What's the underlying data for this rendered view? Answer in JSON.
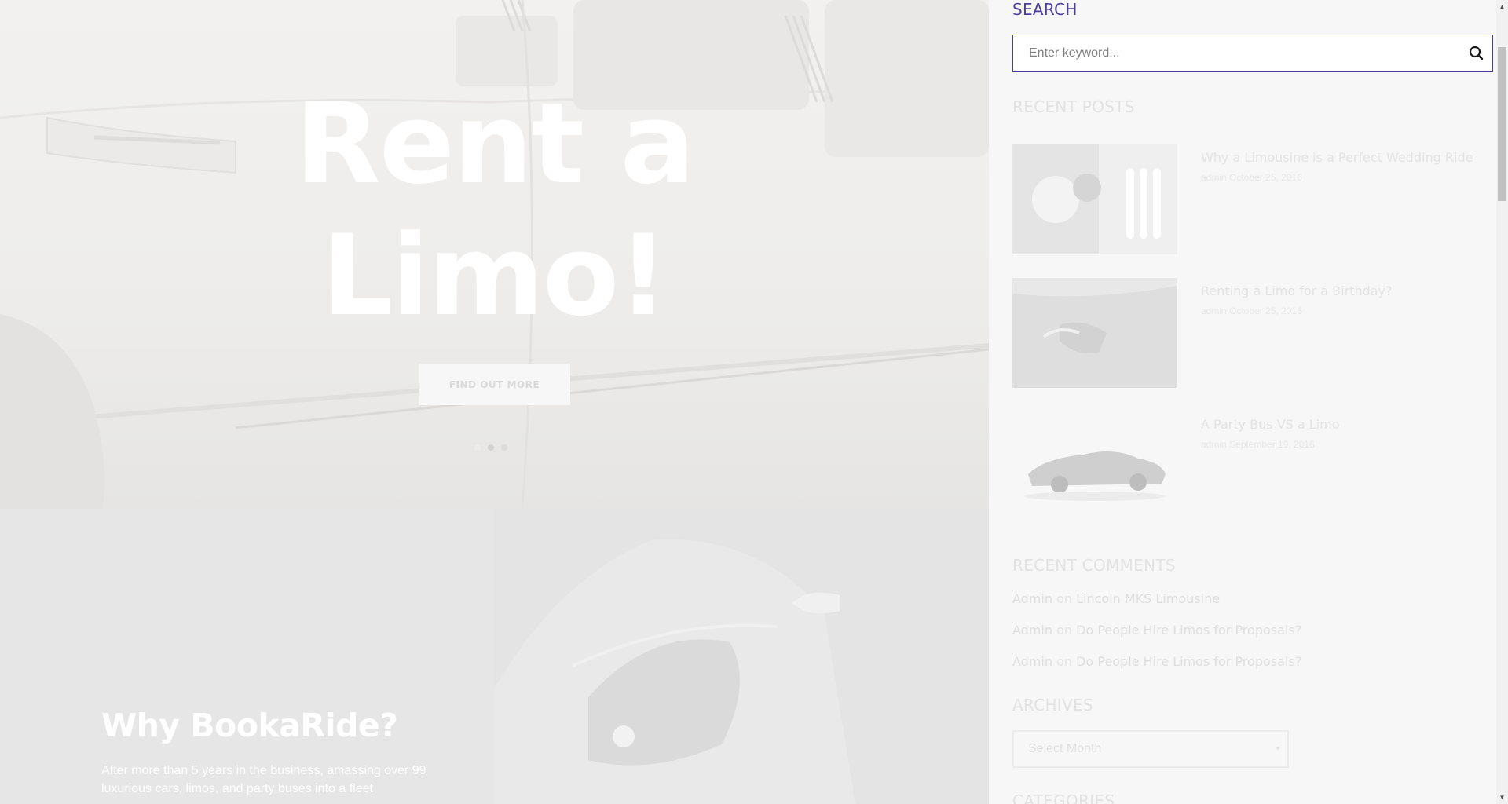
{
  "hero": {
    "title_line1": "Rent a",
    "title_line2": "Limo!",
    "button_label": "FIND OUT MORE",
    "slides": 3,
    "active_slide": 2
  },
  "why": {
    "title": "Why BookaRide?",
    "text": "After more than 5 years in the business, amassing over 99 luxurious cars, limos, and party buses into a fleet"
  },
  "sidebar": {
    "search": {
      "heading": "SEARCH",
      "placeholder": "Enter keyword...",
      "icon": "search-icon"
    },
    "recent_posts": {
      "heading": "RECENT POSTS",
      "items": [
        {
          "title": "Why a Limousine is a Perfect Wedding Ride",
          "author": "admin",
          "date": "October 25, 2016",
          "thumb": "wedding-limo-image"
        },
        {
          "title": "Renting a Limo for a Birthday?",
          "author": "admin",
          "date": "October 25, 2016",
          "thumb": "limo-door-image"
        },
        {
          "title": "A Party Bus VS a Limo",
          "author": "admin",
          "date": "September 19, 2016",
          "thumb": "black-sedan-image"
        }
      ]
    },
    "recent_comments": {
      "heading": "RECENT COMMENTS",
      "items": [
        {
          "author": "Admin",
          "on": "on",
          "post": "Lincoln MKS Limousine"
        },
        {
          "author": "Admin",
          "on": "on",
          "post": "Do People Hire Limos for Proposals?"
        },
        {
          "author": "Admin",
          "on": "on",
          "post": "Do People Hire Limos for Proposals?"
        }
      ]
    },
    "archives": {
      "heading": "ARCHIVES",
      "selected": "Select Month"
    },
    "categories": {
      "heading": "CATEGORIES"
    }
  },
  "colors": {
    "accent": "#4d3f99",
    "overlay_text": "#ffffff",
    "sidebar_bg": "#f7f7f7"
  }
}
